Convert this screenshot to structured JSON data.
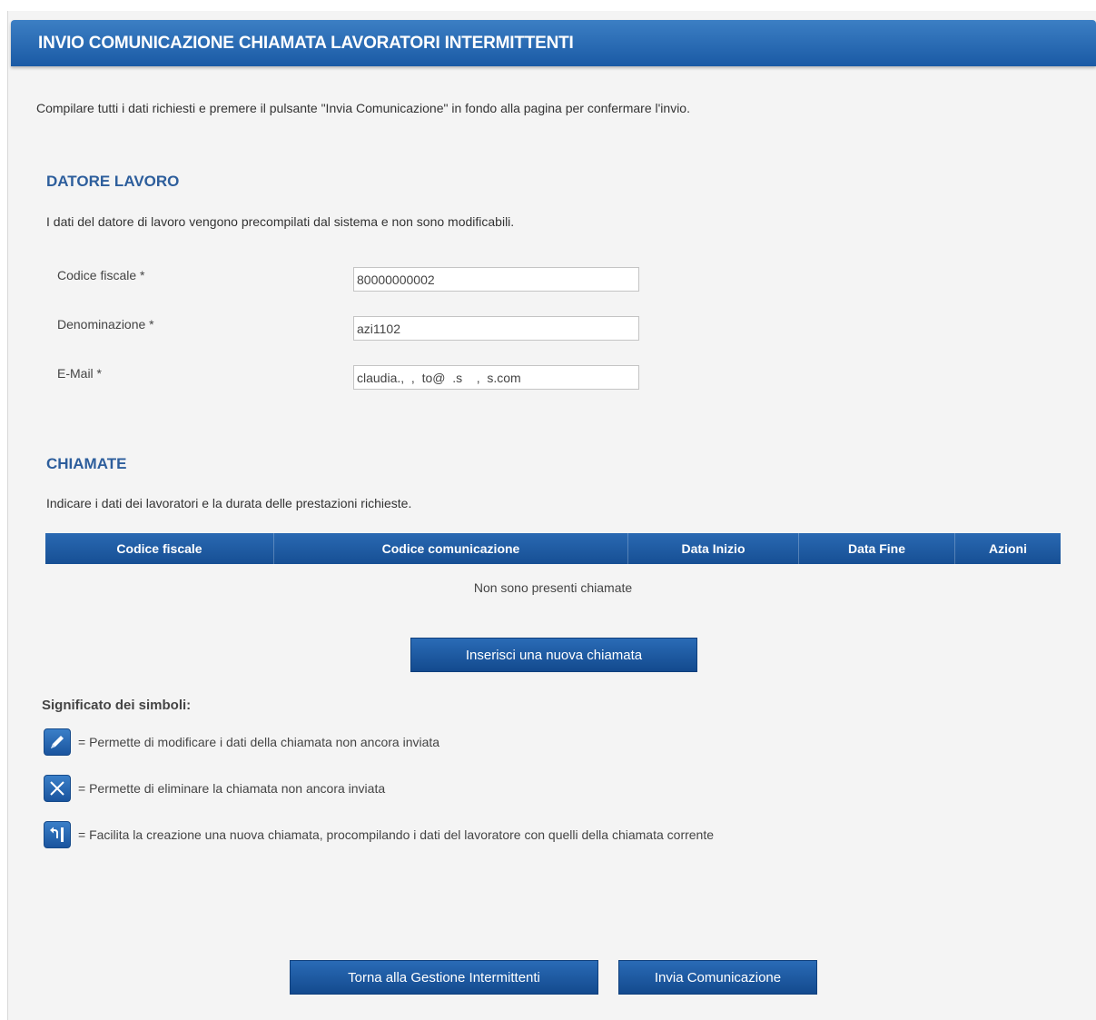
{
  "header": {
    "title": "INVIO COMUNICAZIONE CHIAMATA LAVORATORI INTERMITTENTI"
  },
  "intro_text": "Compilare tutti i dati richiesti e premere il pulsante \"Invia Comunicazione\" in fondo alla pagina per confermare l'invio.",
  "employer": {
    "title": "DATORE LAVORO",
    "description": "I dati del datore di lavoro vengono precompilati dal sistema e non sono modificabili.",
    "fields": [
      {
        "label": "Codice fiscale *",
        "value": "80000000002"
      },
      {
        "label": "Denominazione *",
        "value": "azi1102"
      },
      {
        "label": "E-Mail *",
        "value": "claudia.,  ,  to@  .s    ,  s.com"
      }
    ]
  },
  "calls": {
    "title": "CHIAMATE",
    "description": "Indicare i dati dei lavoratori e la durata delle prestazioni richieste.",
    "columns": [
      "Codice fiscale",
      "Codice comunicazione",
      "Data Inizio",
      "Data Fine",
      "Azioni"
    ],
    "empty_message": "Non sono presenti chiamate",
    "add_button": "Inserisci una nuova chiamata"
  },
  "legend": {
    "title": "Significato dei simboli:",
    "items": [
      {
        "icon": "edit-icon",
        "text": "= Permette di modificare i dati della chiamata non ancora inviata"
      },
      {
        "icon": "delete-icon",
        "text": "= Permette di eliminare la chiamata non ancora inviata"
      },
      {
        "icon": "duplicate-icon",
        "text": "= Facilita la creazione una nuova chiamata, procompilando i dati del lavoratore con quelli della chiamata corrente"
      }
    ]
  },
  "footer": {
    "back_button": "Torna alla Gestione Intermittenti",
    "submit_button": "Invia Comunicazione"
  },
  "colors": {
    "header_blue": "#1f61ac",
    "section_title": "#2d5e9c",
    "button_blue": "#1c5aa2"
  }
}
